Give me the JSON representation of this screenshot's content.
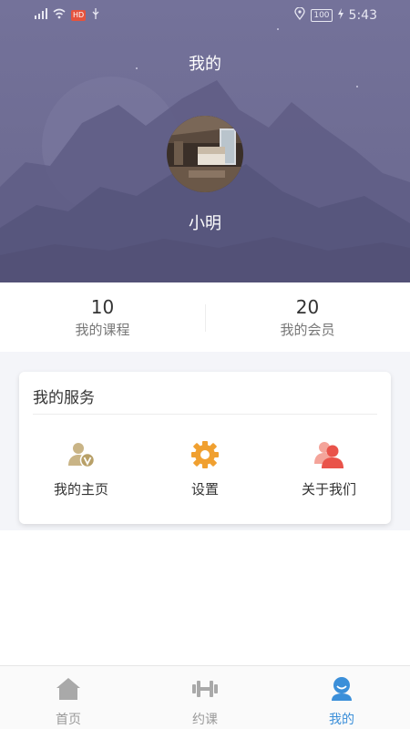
{
  "status_bar": {
    "left_badge": "HD",
    "battery": "100",
    "time": "5:43"
  },
  "header": {
    "title": "我的",
    "username": "小明"
  },
  "stats": [
    {
      "value": "10",
      "label": "我的课程"
    },
    {
      "value": "20",
      "label": "我的会员"
    }
  ],
  "services": {
    "title": "我的服务",
    "items": [
      {
        "label": "我的主页",
        "icon": "profile-vip-icon"
      },
      {
        "label": "设置",
        "icon": "gear-icon"
      },
      {
        "label": "关于我们",
        "icon": "people-icon"
      }
    ]
  },
  "tabbar": {
    "items": [
      {
        "label": "首页",
        "icon": "home-icon"
      },
      {
        "label": "约课",
        "icon": "dumbbell-icon"
      },
      {
        "label": "我的",
        "icon": "user-icon"
      }
    ],
    "active": "我的"
  },
  "colors": {
    "header_bg": "#6f6d94",
    "accent": "#3b8fd9",
    "gear": "#f0a030",
    "people": "#e9534a"
  }
}
